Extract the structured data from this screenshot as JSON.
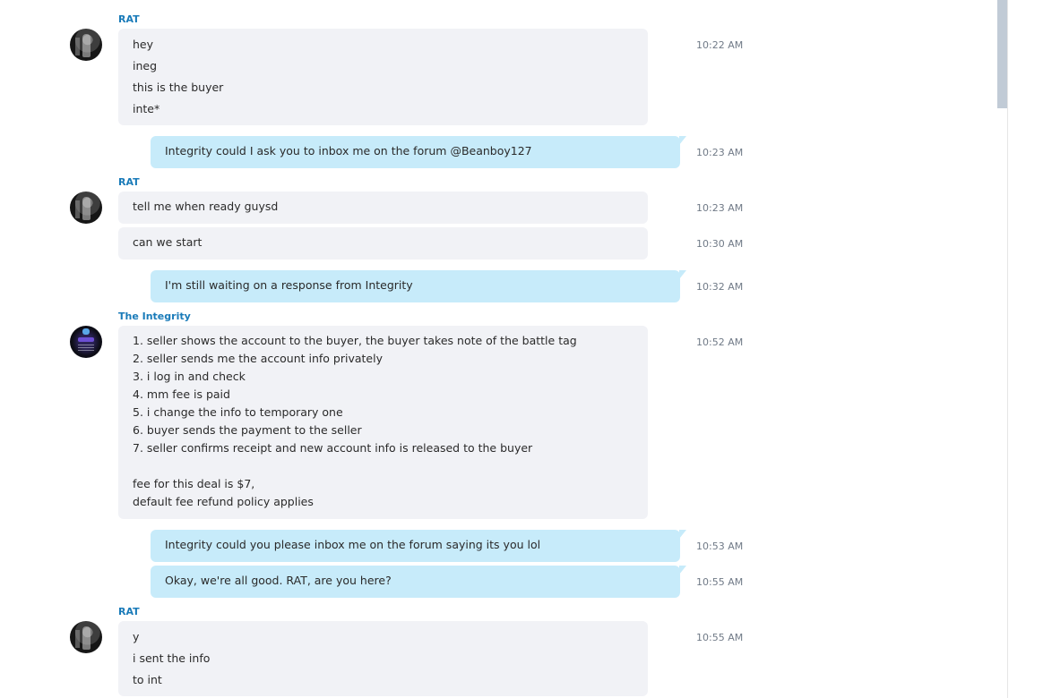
{
  "messages": {
    "g1": {
      "sender": "RAT",
      "lines": [
        "hey",
        "ineg",
        "this is the buyer",
        "inte*"
      ],
      "time": "10:22 AM"
    },
    "o1": {
      "text": "Integrity could I ask you to inbox me on the forum @Beanboy127",
      "time": "10:23 AM"
    },
    "g2": {
      "sender": "RAT",
      "m1": {
        "text": "tell me when ready guysd",
        "time": "10:23 AM"
      },
      "m2": {
        "text": "can we start",
        "time": "10:30 AM"
      }
    },
    "o2": {
      "text": "I'm still waiting on a response from Integrity",
      "time": "10:32 AM"
    },
    "g3": {
      "sender": "The Integrity",
      "lines": [
        "1. seller shows the account to the buyer, the buyer takes note of the battle tag",
        "2. seller sends me the account info privately",
        "3. i log in and check",
        "4. mm fee is paid",
        "5. i change the info to temporary one",
        "6. buyer sends the payment to the seller",
        "7. seller confirms receipt and new account info is released to the buyer",
        "fee for this deal is $7,",
        "default fee refund policy applies"
      ],
      "time": "10:52 AM"
    },
    "o3": {
      "text": "Integrity could you please inbox me on the forum saying its you lol",
      "time": "10:53 AM"
    },
    "o4": {
      "text": "Okay, we're all good. RAT, are you here?",
      "time": "10:55 AM"
    },
    "g4": {
      "sender": "RAT",
      "lines": [
        "y",
        "i sent the info",
        "to int"
      ],
      "time": "10:55 AM"
    }
  },
  "icons": {
    "rat_avatar": "avatar-photo",
    "integrity_avatar": "integrity-logo-avatar"
  },
  "colors": {
    "sender_name": "#1a7bb9",
    "incoming_bubble": "#f1f2f6",
    "outgoing_bubble": "#c7ebfa",
    "timestamp": "#707a87"
  }
}
